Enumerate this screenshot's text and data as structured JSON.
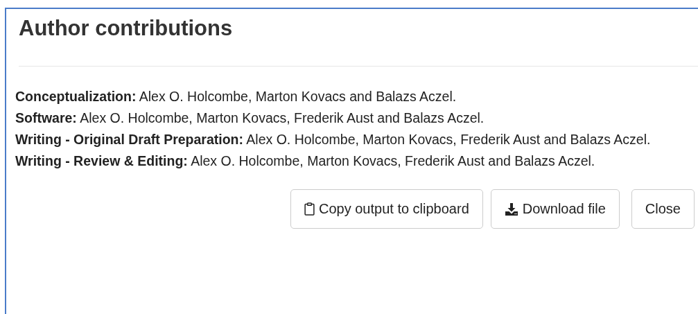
{
  "dialog": {
    "title": "Author contributions",
    "contributions": [
      "**Conceptualization:** Alex O. Holcombe, Marton Kovacs and Balazs Aczel.",
      "**Software:** Alex O. Holcombe, Marton Kovacs, Frederik Aust and Balazs Aczel.",
      "**Writing - Original Draft Preparation:** Alex O. Holcombe, Marton Kovacs, Frederik Aust and Balazs Aczel.",
      "**Writing - Review & Editing:** Alex O. Holcombe, Marton Kovacs, Frederik Aust and Balazs Aczel."
    ],
    "buttons": [
      {
        "kind": "copy",
        "label": "Copy output to clipboard"
      },
      {
        "kind": "download",
        "label": "Download file"
      },
      {
        "kind": "close",
        "label": "Close"
      }
    ]
  }
}
